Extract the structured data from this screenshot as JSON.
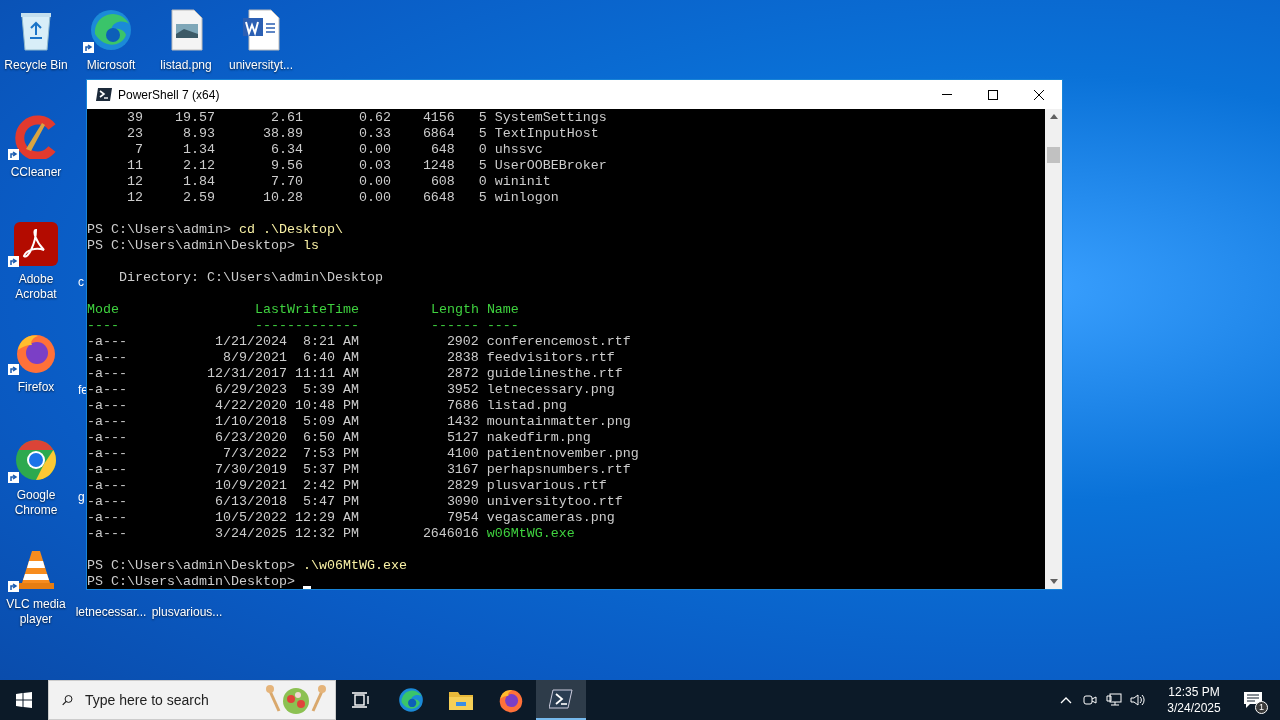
{
  "desktop_icons": [
    {
      "label": "Recycle Bin",
      "kind": "recycle",
      "shortcut": false
    },
    {
      "label": "Microsoft",
      "kind": "edge",
      "shortcut": true
    },
    {
      "label": "listad.png",
      "kind": "image",
      "shortcut": false
    },
    {
      "label": "universityt...",
      "kind": "word",
      "shortcut": false
    },
    {
      "label": "CCleaner",
      "kind": "ccleaner",
      "shortcut": true
    },
    {
      "label": "Adobe Acrobat",
      "kind": "acrobat",
      "shortcut": true
    },
    {
      "label": "Firefox",
      "kind": "firefox",
      "shortcut": true
    },
    {
      "label": "Google Chrome",
      "kind": "chrome",
      "shortcut": true
    },
    {
      "label": "VLC media player",
      "kind": "vlc",
      "shortcut": true
    },
    {
      "label": "letnecessar...",
      "kind": "hidden"
    },
    {
      "label": "plusvarious...",
      "kind": "hidden"
    }
  ],
  "partial_labels": [
    "c",
    "fe",
    "g"
  ],
  "window": {
    "title": "PowerShell 7 (x64)",
    "lines": [
      {
        "kind": "process",
        "cells": [
          "39",
          "19.57",
          "2.61",
          "0.62",
          "4156",
          "5",
          "SystemSettings"
        ]
      },
      {
        "kind": "process",
        "cells": [
          "23",
          "8.93",
          "38.89",
          "0.33",
          "6864",
          "5",
          "TextInputHost"
        ]
      },
      {
        "kind": "process",
        "cells": [
          "7",
          "1.34",
          "6.34",
          "0.00",
          "648",
          "0",
          "uhssvc"
        ]
      },
      {
        "kind": "process",
        "cells": [
          "11",
          "2.12",
          "9.56",
          "0.03",
          "1248",
          "5",
          "UserOOBEBroker"
        ]
      },
      {
        "kind": "process",
        "cells": [
          "12",
          "1.84",
          "7.70",
          "0.00",
          "608",
          "0",
          "wininit"
        ]
      },
      {
        "kind": "process",
        "cells": [
          "12",
          "2.59",
          "10.28",
          "0.00",
          "6648",
          "5",
          "winlogon"
        ]
      },
      {
        "kind": "blank"
      },
      {
        "kind": "prompt",
        "prompt": "PS C:\\Users\\admin>",
        "command": "cd .\\Desktop\\",
        "cursor": false
      },
      {
        "kind": "prompt",
        "prompt": "PS C:\\Users\\admin\\Desktop>",
        "command": "ls",
        "cursor": false
      },
      {
        "kind": "blank"
      },
      {
        "kind": "text",
        "text": "Directory: C:\\Users\\admin\\Desktop"
      },
      {
        "kind": "blank"
      },
      {
        "kind": "header",
        "cells": [
          "Mode",
          "LastWriteTime",
          "Length",
          "Name"
        ]
      },
      {
        "kind": "rule",
        "cells": [
          "----",
          "-------------",
          "------",
          "----"
        ]
      },
      {
        "kind": "file",
        "mode": "-a---",
        "date": "1/21/2024",
        "time": "8:21 AM",
        "length": "2902",
        "name": "conferencemost.rtf",
        "executable": false
      },
      {
        "kind": "file",
        "mode": "-a---",
        "date": "8/9/2021",
        "time": "6:40 AM",
        "length": "2838",
        "name": "feedvisitors.rtf",
        "executable": false
      },
      {
        "kind": "file",
        "mode": "-a---",
        "date": "12/31/2017",
        "time": "11:11 AM",
        "length": "2872",
        "name": "guidelinesthe.rtf",
        "executable": false
      },
      {
        "kind": "file",
        "mode": "-a---",
        "date": "6/29/2023",
        "time": "5:39 AM",
        "length": "3952",
        "name": "letnecessary.png",
        "executable": false
      },
      {
        "kind": "file",
        "mode": "-a---",
        "date": "4/22/2020",
        "time": "10:48 PM",
        "length": "7686",
        "name": "listad.png",
        "executable": false
      },
      {
        "kind": "file",
        "mode": "-a---",
        "date": "1/10/2018",
        "time": "5:09 AM",
        "length": "1432",
        "name": "mountainmatter.png",
        "executable": false
      },
      {
        "kind": "file",
        "mode": "-a---",
        "date": "6/23/2020",
        "time": "6:50 AM",
        "length": "5127",
        "name": "nakedfirm.png",
        "executable": false
      },
      {
        "kind": "file",
        "mode": "-a---",
        "date": "7/3/2022",
        "time": "7:53 PM",
        "length": "4100",
        "name": "patientnovember.png",
        "executable": false
      },
      {
        "kind": "file",
        "mode": "-a---",
        "date": "7/30/2019",
        "time": "5:37 PM",
        "length": "3167",
        "name": "perhapsnumbers.rtf",
        "executable": false
      },
      {
        "kind": "file",
        "mode": "-a---",
        "date": "10/9/2021",
        "time": "2:42 PM",
        "length": "2829",
        "name": "plusvarious.rtf",
        "executable": false
      },
      {
        "kind": "file",
        "mode": "-a---",
        "date": "6/13/2018",
        "time": "5:47 PM",
        "length": "3090",
        "name": "universitytoo.rtf",
        "executable": false
      },
      {
        "kind": "file",
        "mode": "-a---",
        "date": "10/5/2022",
        "time": "12:29 AM",
        "length": "7954",
        "name": "vegascameras.png",
        "executable": false
      },
      {
        "kind": "file",
        "mode": "-a---",
        "date": "3/24/2025",
        "time": "12:32 PM",
        "length": "2646016",
        "name": "w06MtWG.exe",
        "executable": true
      },
      {
        "kind": "blank"
      },
      {
        "kind": "prompt",
        "prompt": "PS C:\\Users\\admin\\Desktop>",
        "command": ".\\w06MtWG.exe",
        "cursor": false
      },
      {
        "kind": "prompt",
        "prompt": "PS C:\\Users\\admin\\Desktop>",
        "cursor": true
      }
    ]
  },
  "taskbar": {
    "search_placeholder": "Type here to search",
    "apps": [
      {
        "kind": "taskview",
        "selected": false
      },
      {
        "kind": "edge",
        "selected": false
      },
      {
        "kind": "explorer",
        "selected": false
      },
      {
        "kind": "firefox",
        "selected": false
      },
      {
        "kind": "powershell",
        "selected": true
      }
    ],
    "time": "12:35 PM",
    "date": "3/24/2025",
    "notifications": "1"
  }
}
